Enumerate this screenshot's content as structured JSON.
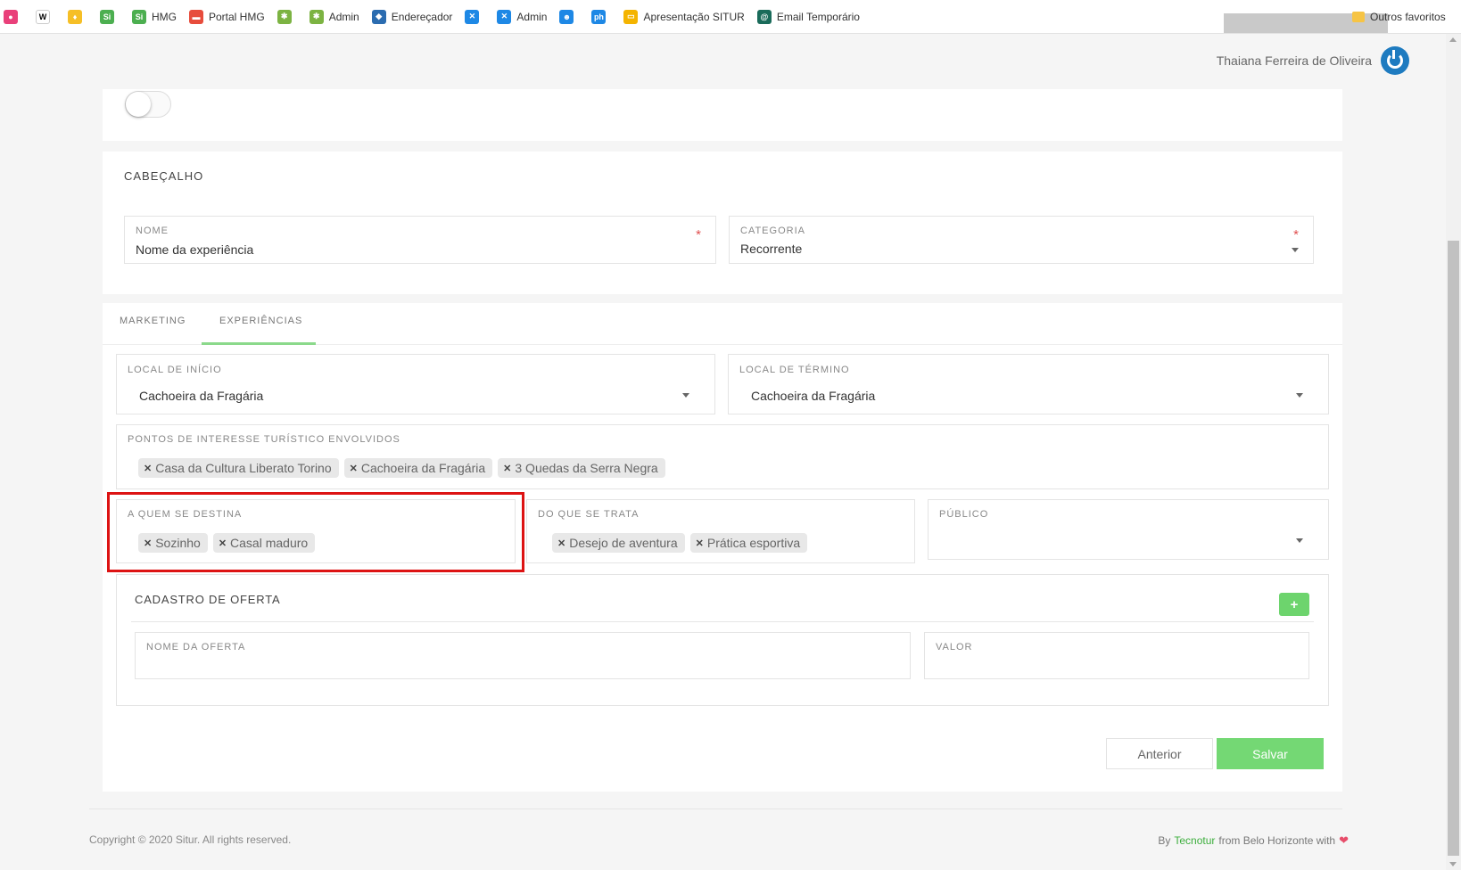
{
  "bookmarks": [
    {
      "label": "",
      "icon": "pink-circle-icon",
      "color": "#e9407a",
      "glyph": "●"
    },
    {
      "label": "",
      "icon": "wikipedia-icon",
      "color": "#ffffff",
      "glyph": "W"
    },
    {
      "label": "",
      "icon": "keep-icon",
      "color": "#f6bf26",
      "glyph": "♦"
    },
    {
      "label": "",
      "icon": "si-icon",
      "color": "#4caf50",
      "glyph": "Si"
    },
    {
      "label": "HMG",
      "icon": "si-icon",
      "color": "#4caf50",
      "glyph": "Si"
    },
    {
      "label": "Portal HMG",
      "icon": "portal-icon",
      "color": "#e74c3c",
      "glyph": "▬"
    },
    {
      "label": "",
      "icon": "admin-star-icon",
      "color": "#7cb342",
      "glyph": "✱"
    },
    {
      "label": "Admin",
      "icon": "admin-star-icon",
      "color": "#7cb342",
      "glyph": "✱"
    },
    {
      "label": "Endereçador",
      "icon": "enderecador-icon",
      "color": "#2b6cb0",
      "glyph": "◆"
    },
    {
      "label": "",
      "icon": "admin-x-icon",
      "color": "#1e88e5",
      "glyph": "✕"
    },
    {
      "label": "Admin",
      "icon": "admin-x-icon",
      "color": "#1e88e5",
      "glyph": "✕"
    },
    {
      "label": "",
      "icon": "reddit-icon",
      "color": "#1e88e5",
      "glyph": "☻"
    },
    {
      "label": "",
      "icon": "ph-icon",
      "color": "#1e88e5",
      "glyph": "ph"
    },
    {
      "label": "Apresentação SITUR",
      "icon": "slides-icon",
      "color": "#f4b400",
      "glyph": "▭"
    },
    {
      "label": "Email Temporário",
      "icon": "email-icon",
      "color": "#1a6b5a",
      "glyph": "@"
    }
  ],
  "bookmark_folder": "Outros favoritos",
  "user_name": "Thaiana Ferreira de Oliveira",
  "header_section": {
    "title": "CABEÇALHO",
    "nome_label": "NOME",
    "nome_value": "Nome da experiência",
    "required_mark": "*",
    "categoria_label": "CATEGORIA",
    "categoria_value": "Recorrente"
  },
  "tabs": {
    "marketing": "MARKETING",
    "experiencias": "EXPERIÊNCIAS"
  },
  "local_inicio": {
    "label": "LOCAL DE INÍCIO",
    "value": "Cachoeira da Fragária"
  },
  "local_termino": {
    "label": "LOCAL DE TÉRMINO",
    "value": "Cachoeira da Fragária"
  },
  "pontos": {
    "label": "PONTOS DE INTERESSE TURÍSTICO ENVOLVIDOS",
    "chips": [
      "Casa da Cultura Liberato Torino",
      "Cachoeira da Fragária",
      "3 Quedas da Serra Negra"
    ]
  },
  "a_quem": {
    "label": "A QUEM SE DESTINA",
    "chips": [
      "Sozinho",
      "Casal maduro"
    ]
  },
  "do_que": {
    "label": "DO QUE SE TRATA",
    "chips": [
      "Desejo de aventura",
      "Prática esportiva"
    ]
  },
  "publico": {
    "label": "PÚBLICO",
    "value": ""
  },
  "oferta": {
    "title": "CADASTRO DE OFERTA",
    "add_label": "+",
    "nome_label": "NOME DA OFERTA",
    "valor_label": "VALOR"
  },
  "buttons": {
    "anterior": "Anterior",
    "salvar": "Salvar"
  },
  "footer": {
    "copyright": "Copyright © 2020 Situr. All rights reserved.",
    "by": "By",
    "brand": "Tecnotur",
    "from": "from Belo Horizonte with",
    "heart": "❤"
  },
  "colors": {
    "accent_green": "#74d874",
    "highlight_red": "#dd1313",
    "power_blue": "#1e7bc0"
  }
}
